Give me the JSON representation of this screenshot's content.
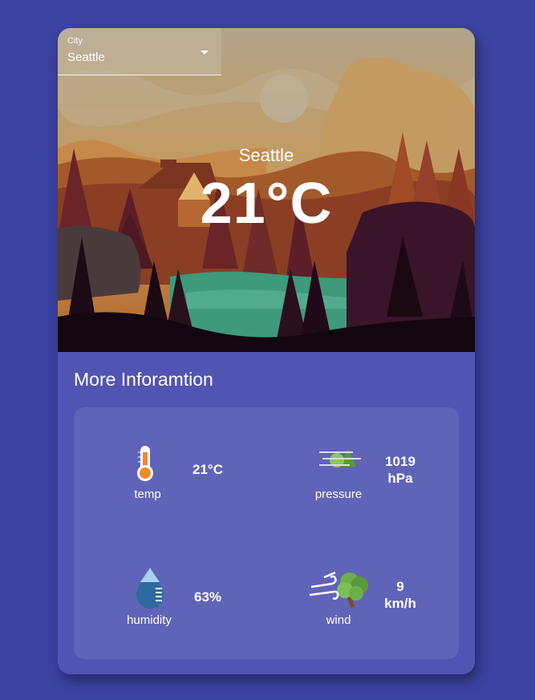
{
  "city_select": {
    "label": "City",
    "value": "Seattle"
  },
  "hero": {
    "city": "Seattle",
    "temperature": "21°C"
  },
  "more_info": {
    "title": "More Inforamtion",
    "items": [
      {
        "id": "temp",
        "caption": "temp",
        "value_line1": "21°C",
        "value_line2": "",
        "icon": "thermometer-icon"
      },
      {
        "id": "pressure",
        "caption": "pressure",
        "value_line1": "1019",
        "value_line2": "hPa",
        "icon": "pressure-icon"
      },
      {
        "id": "humidity",
        "caption": "humidity",
        "value_line1": "63%",
        "value_line2": "",
        "icon": "water-drop-icon"
      },
      {
        "id": "wind",
        "caption": "wind",
        "value_line1": "9",
        "value_line2": "km/h",
        "icon": "wind-tree-icon"
      }
    ]
  },
  "colors": {
    "page_background": "#3c42a0",
    "card_background": "#5254b3",
    "panel_background": "#6064b8",
    "text": "#ffffff"
  }
}
